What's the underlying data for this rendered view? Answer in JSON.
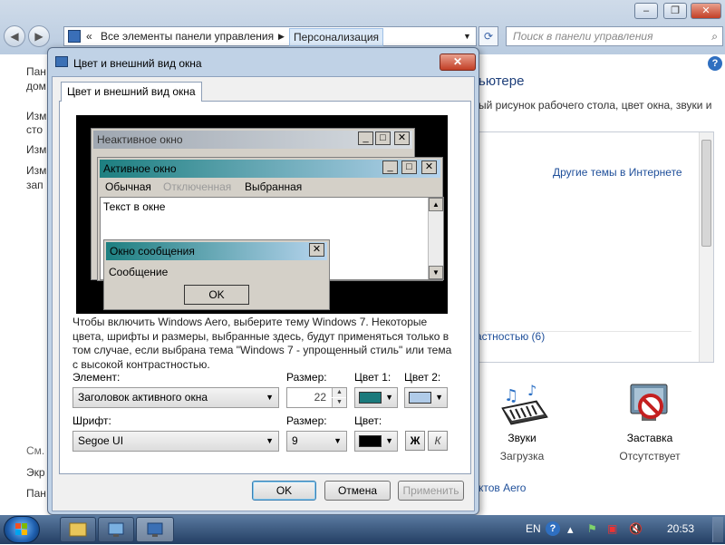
{
  "explorer": {
    "address_prefix": "«",
    "address_path": "Все элементы панели управления",
    "address_current": "Персонализация",
    "search_placeholder": "Поиск в панели управления",
    "window_controls": [
      "–",
      "❐",
      "✕"
    ],
    "left_pane": [
      "Пан",
      "дом",
      "Изм",
      "сто",
      "Изм",
      "Изм",
      "зап"
    ],
    "left_pane_bottom": [
      "См.",
      "Экр",
      "Пан"
    ],
    "right_heading": "ьютере",
    "right_desc": "ый рисунок рабочего стола, цвет окна, звуки и",
    "online_themes_link": "Другие темы в Интернете",
    "contrast_themes": "астностью (6)",
    "aero_link": "ктов Aero",
    "sounds": {
      "label": "Звуки",
      "value": "Загрузка"
    },
    "screensaver": {
      "label": "Заставка",
      "value": "Отсутствует"
    }
  },
  "dialog": {
    "title": "Цвет и внешний вид окна",
    "tab": "Цвет и внешний вид окна",
    "preview": {
      "inactive_title": "Неактивное окно",
      "active_title": "Активное окно",
      "menu": [
        "Обычная",
        "Отключенная",
        "Выбранная"
      ],
      "window_text": "Текст в окне",
      "msg_title": "Окно сообщения",
      "msg_text": "Сообщение",
      "msg_ok": "OK"
    },
    "description": "Чтобы включить Windows Aero, выберите тему Windows 7. Некоторые цвета, шрифты и размеры, выбранные здесь, будут применяться только в том случае, если выбрана тема \"Windows 7 - упрощенный стиль\" или тема с высокой контрастностью.",
    "element_label": "Элемент:",
    "element_value": "Заголовок активного окна",
    "size_label": "Размер:",
    "size_value": "22",
    "color1_label": "Цвет 1:",
    "color2_label": "Цвет 2:",
    "color1": "#1a7a7c",
    "color2": "#b0cbe8",
    "font_label": "Шрифт:",
    "font_value": "Segoe UI",
    "font_size_label": "Размер:",
    "font_size_value": "9",
    "font_color_label": "Цвет:",
    "font_color": "#000000",
    "bold": "Ж",
    "italic": "К",
    "ok": "OK",
    "cancel": "Отмена",
    "apply": "Применить"
  },
  "taskbar": {
    "lang": "EN",
    "time": "20:53"
  }
}
